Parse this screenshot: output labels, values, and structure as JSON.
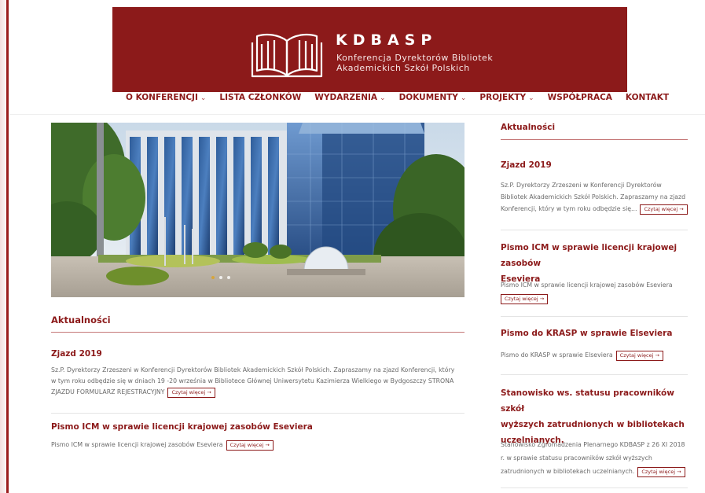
{
  "header": {
    "title": "KDBASP",
    "subtitle_line1": "Konferencja Dyrektorów Bibliotek",
    "subtitle_line2": "Akademickich Szkół Polskich",
    "brand_color": "#8c1a1a"
  },
  "nav": {
    "items": [
      {
        "label": "O KONFERENCJI",
        "dropdown": true
      },
      {
        "label": "LISTA CZŁONKÓW",
        "dropdown": false
      },
      {
        "label": "WYDARZENIA",
        "dropdown": true
      },
      {
        "label": "DOKUMENTY",
        "dropdown": true
      },
      {
        "label": "PROJEKTY",
        "dropdown": true
      },
      {
        "label": "WSPÓŁPRACA",
        "dropdown": false
      },
      {
        "label": "KONTAKT",
        "dropdown": false
      }
    ],
    "caret": "⌄"
  },
  "main": {
    "section_title": "Aktualności",
    "posts": [
      {
        "title": "Zjazd 2019",
        "line1": "Sz.P. Dyrektorzy Zrzeszeni w Konferencji Dyrektorów Bibliotek Akademickich Szkół Polskich. Zapraszamy na zjazd Konferencji, który",
        "line2": "w tym roku odbędzie się w dniach 19 -20 września w Bibliotece Głównej Uniwersytetu Kazimierza Wielkiego w Bydgoszczy STRONA",
        "line3": "ZJAZDU FORMULARZ REJESTRACYJNY",
        "read_more": "Czytaj więcej →"
      },
      {
        "title": "Pismo ICM w sprawie licencji krajowej zasobów Eseviera",
        "line1": "Pismo ICM w sprawie licencji krajowej zasobów Eseviera",
        "read_more": "Czytaj więcej →"
      }
    ]
  },
  "sidebar": {
    "section_title": "Aktualności",
    "posts": [
      {
        "title_lines": [
          "Zjazd 2019"
        ],
        "lines": [
          "Sz.P. Dyrektorzy Zrzeszeni w Konferencji Dyrektorów",
          "Bibliotek Akademickich Szkół Polskich. Zapraszamy na zjazd",
          "Konferencji, który w tym roku odbędzie się..."
        ],
        "read_more": "Czytaj więcej →"
      },
      {
        "title_lines": [
          "Pismo ICM w sprawie licencji krajowej zasobów",
          "Eseviera"
        ],
        "lines": [
          "Pismo ICM w sprawie licencji krajowej zasobów Eseviera"
        ],
        "read_more": "Czytaj więcej →"
      },
      {
        "title_lines": [
          "Pismo do KRASP w sprawie Elseviera"
        ],
        "lines": [
          "Pismo do KRASP w sprawie Elseviera"
        ],
        "read_more": "Czytaj więcej →"
      },
      {
        "title_lines": [
          "Stanowisko ws. statusu pracowników szkół",
          "wyższych zatrudnionych w bibliotekach",
          "uczelnianych."
        ],
        "lines": [
          "Stanowisko Zgromadzenia Plenarnego KDBASP z 26 XI 2018",
          "r. w sprawie statusu pracowników szkół wyższych",
          "zatrudnionych w bibliotekach uczelnianych."
        ],
        "read_more": "Czytaj więcej →"
      }
    ]
  }
}
